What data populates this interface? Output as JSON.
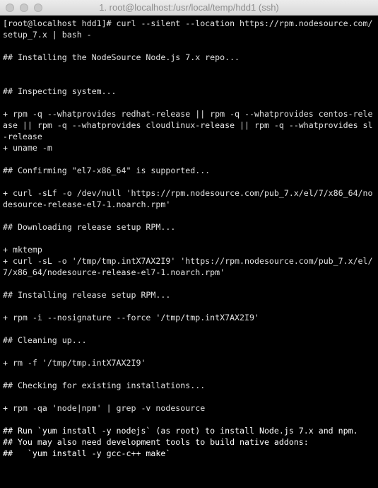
{
  "window": {
    "title": "1. root@localhost:/usr/local/temp/hdd1 (ssh)"
  },
  "terminal": {
    "lines": [
      "[root@localhost hdd1]# curl --silent --location https://rpm.nodesource.com/",
      "setup_7.x | bash -",
      "",
      "## Installing the NodeSource Node.js 7.x repo...",
      "",
      "",
      "## Inspecting system...",
      "",
      "+ rpm -q --whatprovides redhat-release || rpm -q --whatprovides centos-rele",
      "ase || rpm -q --whatprovides cloudlinux-release || rpm -q --whatprovides sl",
      "-release",
      "+ uname -m",
      "",
      "## Confirming \"el7-x86_64\" is supported...",
      "",
      "+ curl -sLf -o /dev/null 'https://rpm.nodesource.com/pub_7.x/el/7/x86_64/no",
      "desource-release-el7-1.noarch.rpm'",
      "",
      "## Downloading release setup RPM...",
      "",
      "+ mktemp",
      "+ curl -sL -o '/tmp/tmp.intX7AX2I9' 'https://rpm.nodesource.com/pub_7.x/el/",
      "7/x86_64/nodesource-release-el7-1.noarch.rpm'",
      "",
      "## Installing release setup RPM...",
      "",
      "+ rpm -i --nosignature --force '/tmp/tmp.intX7AX2I9'",
      "",
      "## Cleaning up...",
      "",
      "+ rm -f '/tmp/tmp.intX7AX2I9'",
      "",
      "## Checking for existing installations...",
      "",
      "+ rpm -qa 'node|npm' | grep -v nodesource",
      "",
      "## Run `yum install -y nodejs` (as root) to install Node.js 7.x and npm.",
      "## You may also need development tools to build native addons:",
      "##   `yum install -y gcc-c++ make`"
    ]
  }
}
